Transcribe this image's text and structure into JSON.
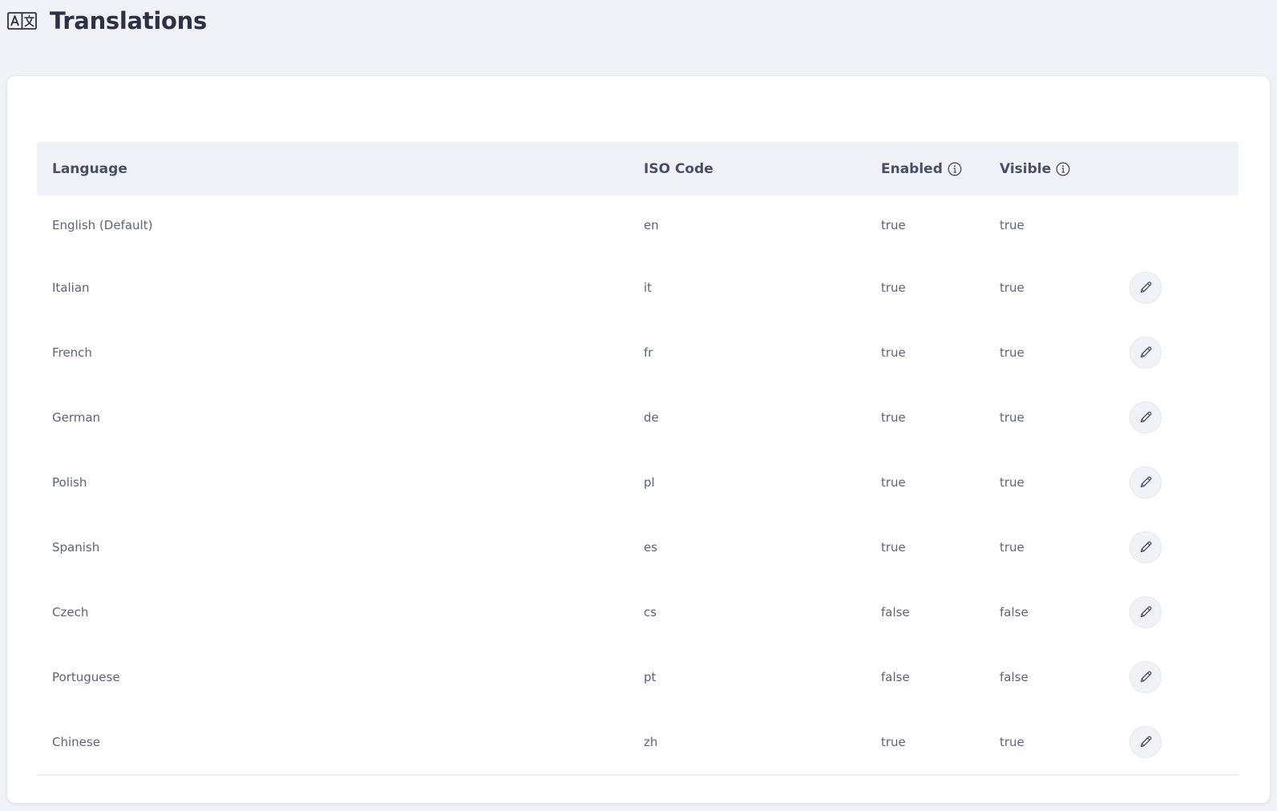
{
  "page": {
    "title": "Translations",
    "title_icon": "translate-icon"
  },
  "table": {
    "headers": {
      "language": "Language",
      "iso_code": "ISO Code",
      "enabled": "Enabled",
      "visible": "Visible"
    },
    "rows": [
      {
        "language": "English (Default)",
        "iso": "en",
        "enabled": "true",
        "visible": "true",
        "editable": false
      },
      {
        "language": "Italian",
        "iso": "it",
        "enabled": "true",
        "visible": "true",
        "editable": true
      },
      {
        "language": "French",
        "iso": "fr",
        "enabled": "true",
        "visible": "true",
        "editable": true
      },
      {
        "language": "German",
        "iso": "de",
        "enabled": "true",
        "visible": "true",
        "editable": true
      },
      {
        "language": "Polish",
        "iso": "pl",
        "enabled": "true",
        "visible": "true",
        "editable": true
      },
      {
        "language": "Spanish",
        "iso": "es",
        "enabled": "true",
        "visible": "true",
        "editable": true
      },
      {
        "language": "Czech",
        "iso": "cs",
        "enabled": "false",
        "visible": "false",
        "editable": true
      },
      {
        "language": "Portuguese",
        "iso": "pt",
        "enabled": "false",
        "visible": "false",
        "editable": true
      },
      {
        "language": "Chinese",
        "iso": "zh",
        "enabled": "true",
        "visible": "true",
        "editable": true
      }
    ]
  },
  "colors": {
    "background": "#f1f2f7",
    "card": "#ffffff",
    "header_text": "#4b4e68",
    "cell_text": "#5f6379"
  }
}
